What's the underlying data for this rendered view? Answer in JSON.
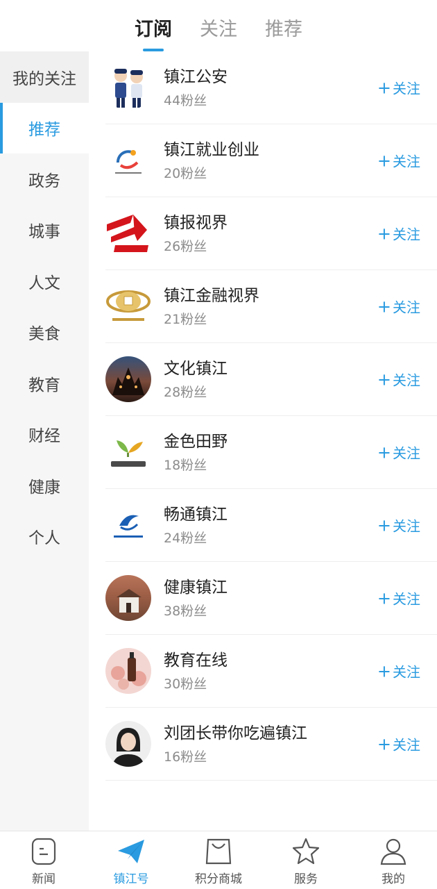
{
  "top_tabs": [
    "订阅",
    "关注",
    "推荐"
  ],
  "sidebar": {
    "items": [
      "我的关注",
      "推荐",
      "政务",
      "城事",
      "人文",
      "美食",
      "教育",
      "财经",
      "健康",
      "个人"
    ]
  },
  "follow_label": "关注",
  "follow_plus": "+",
  "accounts": [
    {
      "name": "镇江公安",
      "fans": "44粉丝"
    },
    {
      "name": "镇江就业创业",
      "fans": "20粉丝"
    },
    {
      "name": "镇报视界",
      "fans": "26粉丝"
    },
    {
      "name": "镇江金融视界",
      "fans": "21粉丝"
    },
    {
      "name": "文化镇江",
      "fans": "28粉丝"
    },
    {
      "name": "金色田野",
      "fans": "18粉丝"
    },
    {
      "name": "畅通镇江",
      "fans": "24粉丝"
    },
    {
      "name": "健康镇江",
      "fans": "38粉丝"
    },
    {
      "name": "教育在线",
      "fans": "30粉丝"
    },
    {
      "name": "刘团长带你吃遍镇江",
      "fans": "16粉丝"
    }
  ],
  "bottom_nav": [
    "新闻",
    "镇江号",
    "积分商城",
    "服务",
    "我的"
  ],
  "colors": {
    "accent": "#2a9be0"
  }
}
